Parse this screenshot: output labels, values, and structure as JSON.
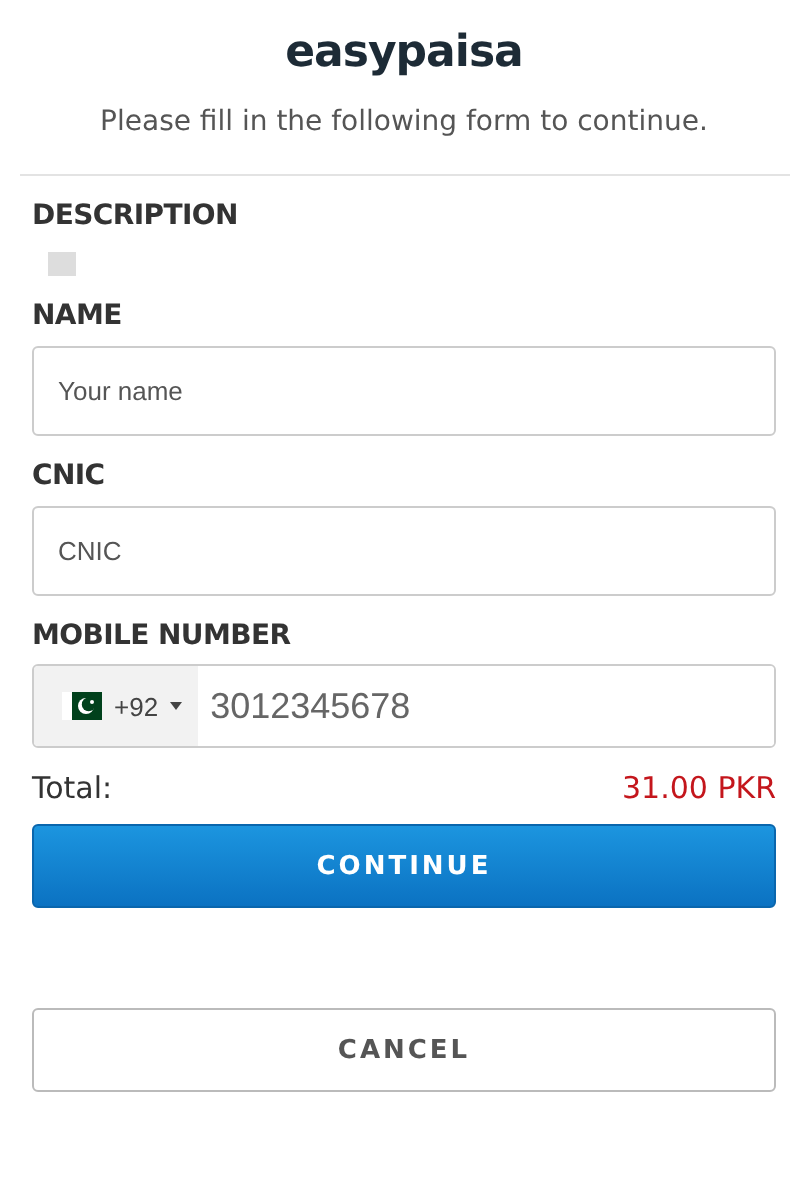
{
  "logo": "easypaisa",
  "subtitle": "Please fill in the following form to continue.",
  "description": {
    "label": "DESCRIPTION"
  },
  "fields": [
    {
      "label": "NAME",
      "placeholder": "Your name"
    },
    {
      "label": "CNIC",
      "placeholder": "CNIC"
    }
  ],
  "mobile": {
    "label": "MOBILE NUMBER",
    "code": "+92",
    "placeholder": "3012345678"
  },
  "total": {
    "label": "Total:",
    "amount": "31.00 PKR"
  },
  "buttons": [
    {
      "label": "CONTINUE",
      "kind": "primary"
    },
    {
      "label": "CANCEL",
      "kind": "secondary"
    }
  ]
}
